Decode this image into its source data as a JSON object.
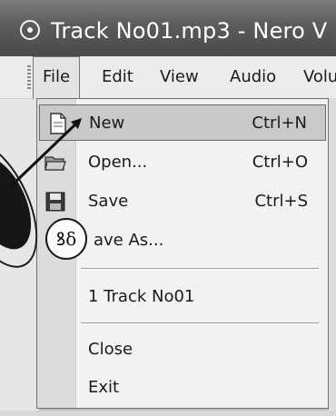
{
  "window": {
    "title": "Track No01.mp3 - Nero V"
  },
  "menubar": {
    "items": [
      {
        "label": "File",
        "active": true
      },
      {
        "label": "Edit"
      },
      {
        "label": "View"
      },
      {
        "label": "Audio"
      },
      {
        "label": "Volu"
      }
    ]
  },
  "file_menu": {
    "items": [
      {
        "label": "New",
        "shortcut": "Ctrl+N",
        "icon": "new-document-icon",
        "highlighted": true
      },
      {
        "label": "Open...",
        "shortcut": "Ctrl+O",
        "icon": "open-folder-icon"
      },
      {
        "label": "Save",
        "shortcut": "Ctrl+S",
        "icon": "floppy-disk-icon"
      },
      {
        "label": "ave As...",
        "shortcut": ""
      },
      {
        "label": "1 Track No01",
        "shortcut": ""
      },
      {
        "label": "Close",
        "shortcut": ""
      },
      {
        "label": "Exit",
        "shortcut": ""
      }
    ]
  },
  "annotation": {
    "callout_text": "ꝸδ"
  },
  "colors": {
    "title_bar": "#5b5b5b",
    "menu_bg": "#ececea",
    "highlight": "#c9c9c7"
  }
}
